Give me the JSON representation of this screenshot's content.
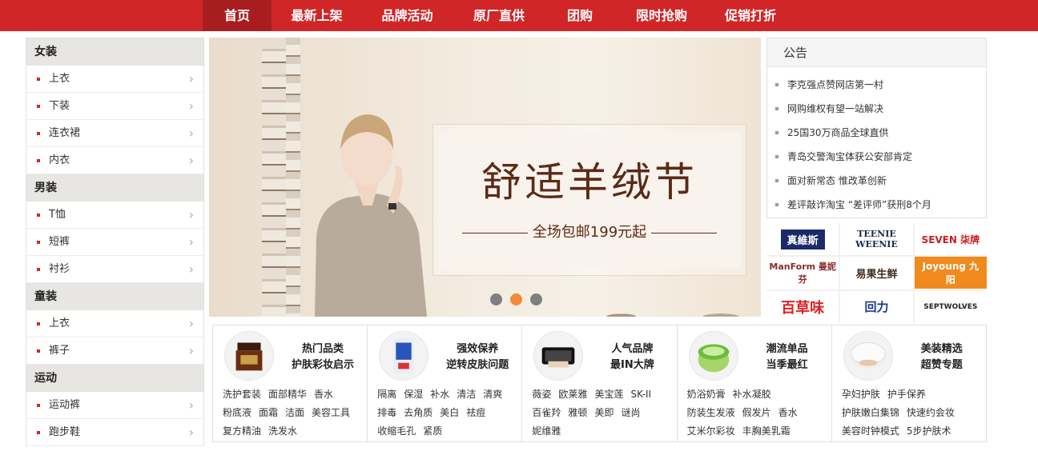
{
  "nav": [
    "首页",
    "最新上架",
    "品牌活动",
    "原厂直供",
    "团购",
    "限时抢购",
    "促销打折"
  ],
  "sidebar": [
    {
      "label": "女装",
      "items": [
        "上衣",
        "下装",
        "连衣裙",
        "内衣"
      ]
    },
    {
      "label": "男装",
      "items": [
        "T恤",
        "短裤",
        "衬衫"
      ]
    },
    {
      "label": "童装",
      "items": [
        "上衣",
        "裤子"
      ]
    },
    {
      "label": "运动",
      "items": [
        "运动裤",
        "跑步鞋"
      ]
    }
  ],
  "banner": {
    "title": "舒适羊绒节",
    "subtitle": "全场包邮199元起",
    "active_slide": 2
  },
  "notice": {
    "title": "公告",
    "items": [
      "李克强点赞网店第一村",
      "网购维权有望一站解决",
      "25国30万商品全球直供",
      "青岛交警淘宝体获公安部肯定",
      "面对新常态 惟改革创新",
      "差评敲诈淘宝 “差评师”获刑8个月"
    ]
  },
  "brands": [
    "真維斯",
    "TEENIE WEENIE",
    "SEVEN 柒牌",
    "ManForm 曼妮芬",
    "易果生鲜",
    "Joyoung 九阳",
    "百草味",
    "回力",
    "SEPTWOLVES"
  ],
  "products": [
    {
      "title1": "热门品类",
      "title2": "护肤彩妆启示",
      "links": [
        "洗护套装",
        "面部精华",
        "香水",
        "粉底液",
        "面霜",
        "洁面",
        "美容工具",
        "复方精油",
        "洗发水"
      ]
    },
    {
      "title1": "强效保养",
      "title2": "逆转皮肤问题",
      "links": [
        "隔离",
        "保湿",
        "补水",
        "清洁",
        "清爽",
        "排毒",
        "去角质",
        "美白",
        "祛痘",
        "收缩毛孔",
        "紧质"
      ]
    },
    {
      "title1": "人气品牌",
      "title2": "最IN大牌",
      "links": [
        "薇姿",
        "欧莱雅",
        "美宝莲",
        "SK-II",
        "百雀羚",
        "雅顿",
        "美即",
        "谜尚",
        "妮维雅"
      ]
    },
    {
      "title1": "潮流单品",
      "title2": "当季最红",
      "links": [
        "奶浴奶膏",
        "补水凝胶",
        "防装生发液",
        "假发片",
        "香水",
        "艾米尔彩妆",
        "丰胸美乳霜"
      ]
    },
    {
      "title1": "美装精选",
      "title2": "超赞专题",
      "links": [
        "孕妇护肤",
        "护手保养",
        "护肤嫩白集锦",
        "快速约会妆",
        "美容时钟模式",
        "5步护肤术"
      ]
    }
  ],
  "colors": {
    "accent": "#d02628",
    "nav_active": "#a81e20",
    "banner_text": "#5b2a17",
    "dot_active": "#f08a3b"
  }
}
